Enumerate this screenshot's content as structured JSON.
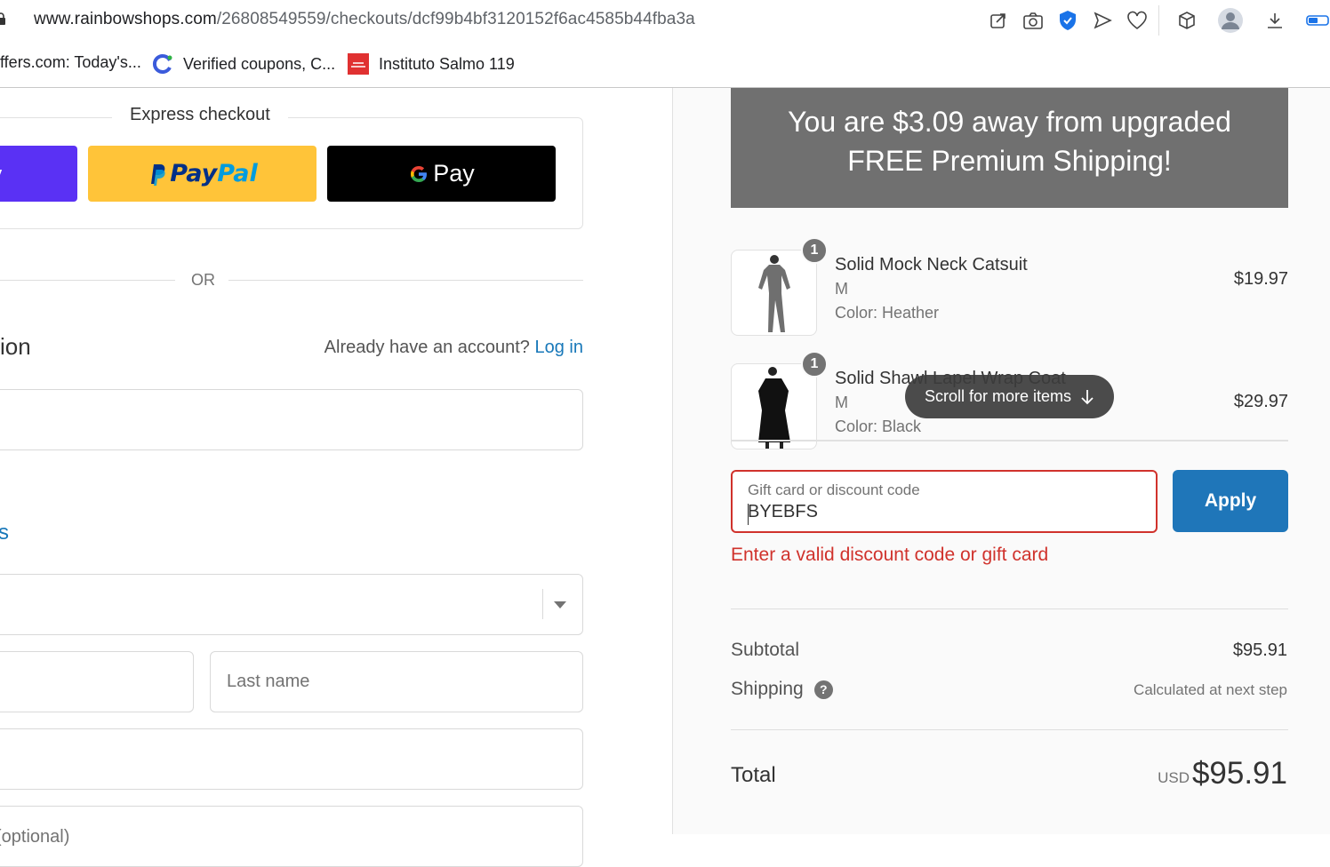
{
  "browser": {
    "url_domain": "www.rainbowshops.com",
    "url_path": "/26808549559/checkouts/dcf99b4bf3120152f6ac4585b44fba3a",
    "bookmarks": [
      {
        "label": "ffers.com: Today's..."
      },
      {
        "label": "Verified coupons, C..."
      },
      {
        "label": "Instituto Salmo 119"
      }
    ],
    "toolbar_icons": [
      "share-icon",
      "camera-icon",
      "shield-check-icon",
      "send-icon",
      "heart-icon",
      "cube-icon",
      "profile-icon",
      "download-icon",
      "battery-icon"
    ]
  },
  "checkout": {
    "express_title": "Express checkout",
    "shop_pay_peek": "y",
    "paypal": {
      "p1": "Pay",
      "p2": "Pal"
    },
    "gpay_label": "Pay",
    "or_label": "OR",
    "contact_heading_peek": "ion",
    "account_prompt": "Already have an account?",
    "login_link": "Log in",
    "shipping_heading_peek": "s",
    "last_name_placeholder": "Last name",
    "optional_peek": " (optional)"
  },
  "summary": {
    "promo_line1": "You are $3.09 away from upgraded",
    "promo_line2": "FREE Premium Shipping!",
    "items": [
      {
        "qty": "1",
        "name": "Solid Mock Neck Catsuit",
        "size": "M",
        "color": "Color: Heather",
        "price": "$19.97"
      },
      {
        "qty": "1",
        "name": "Solid Shawl Lapel Wrap Coat",
        "size": "M",
        "color": "Color: Black",
        "price": "$29.97"
      }
    ],
    "scroll_hint": "Scroll for more items",
    "discount_label": "Gift card or discount code",
    "discount_value": "BYEBFS",
    "apply_label": "Apply",
    "error_text": "Enter a valid discount code or gift card",
    "subtotal_label": "Subtotal",
    "subtotal_value": "$95.91",
    "shipping_label": "Shipping",
    "shipping_value": "Calculated at next step",
    "total_label": "Total",
    "total_currency": "USD",
    "total_value": "$95.91"
  },
  "colors": {
    "accent": "#1f76b9",
    "error": "#d0322c",
    "promo_bg": "#707070",
    "paypal_yellow": "#ffc439",
    "shop_pay_purple": "#5a31f4"
  }
}
